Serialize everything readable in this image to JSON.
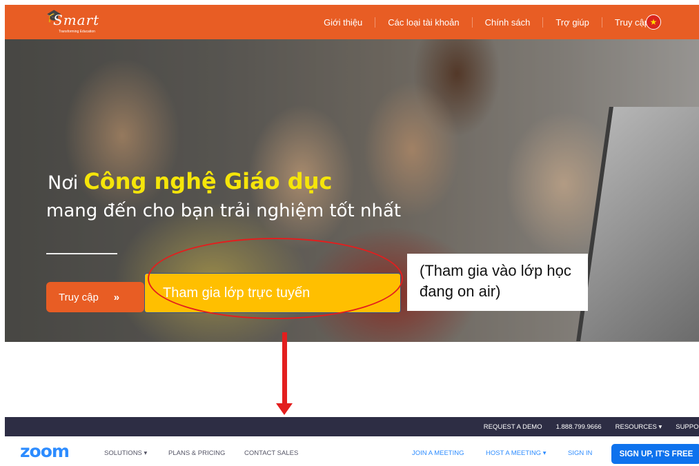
{
  "ismart": {
    "logo": {
      "text": "Smart",
      "tagline": "Transforming Education",
      "icon": "graduation-hat-icon"
    },
    "nav": {
      "items": [
        "Giới thiệu",
        "Các loại tài khoản",
        "Chính sách",
        "Trợ giúp",
        "Truy cập"
      ],
      "flag_icon": "vietnam-flag-icon"
    },
    "hero": {
      "headline_prefix": "Nơi",
      "headline_highlight": "Công nghệ Giáo dục",
      "subheadline": "mang đến cho bạn trải nghiệm tốt nhất",
      "access_button": "Truy cập",
      "access_button_icon": "double-chevron-right-icon"
    },
    "colors": {
      "brand_orange": "#e85d24",
      "highlight_yellow": "#f5e50a"
    }
  },
  "annotations": {
    "join_callout": "Tham gia lớp trực tuyến",
    "note": "(Tham gia vào lớp học đang on air)",
    "colors": {
      "callout_fill": "#ffbf00",
      "ellipse_red": "#e31e1e",
      "arrow_red": "#e31e1e"
    }
  },
  "zoom": {
    "top_bar": {
      "request_demo": "REQUEST A DEMO",
      "phone": "1.888.799.9666",
      "resources": "RESOURCES ▾",
      "support": "SUPPORT"
    },
    "logo": "zoom",
    "nav": {
      "solutions": "SOLUTIONS ▾",
      "plans_pricing": "PLANS & PRICING",
      "contact_sales": "CONTACT SALES",
      "join_meeting": "JOIN A MEETING",
      "host_meeting": "HOST A MEETING ▾",
      "sign_in": "SIGN IN",
      "sign_up": "SIGN UP, IT'S FREE"
    },
    "colors": {
      "top_bar_bg": "#2d2d44",
      "brand_blue": "#2d8cff",
      "button_blue": "#0e72ed"
    }
  }
}
